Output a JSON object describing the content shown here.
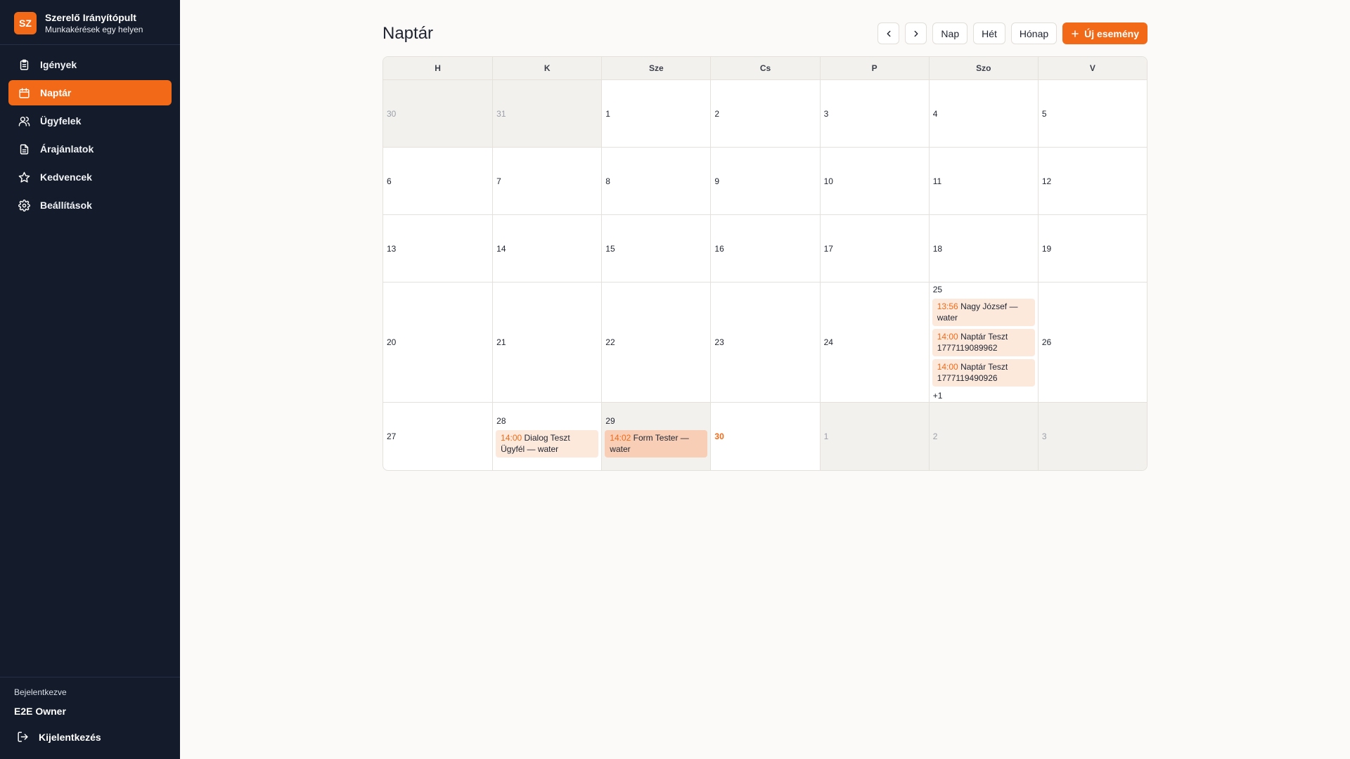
{
  "app": {
    "logo": "SZ",
    "title": "Szerelő Irányítópult",
    "subtitle": "Munkakérések egy helyen"
  },
  "nav": [
    {
      "label": "Igények",
      "icon": "clipboard-icon",
      "active": false
    },
    {
      "label": "Naptár",
      "icon": "calendar-icon",
      "active": true
    },
    {
      "label": "Ügyfelek",
      "icon": "users-icon",
      "active": false
    },
    {
      "label": "Árajánlatok",
      "icon": "document-icon",
      "active": false
    },
    {
      "label": "Kedvencek",
      "icon": "star-icon",
      "active": false
    },
    {
      "label": "Beállítások",
      "icon": "gear-icon",
      "active": false
    }
  ],
  "footer": {
    "logged_in_label": "Bejelentkezve",
    "user_name": "E2E Owner",
    "logout_label": "Kijelentkezés"
  },
  "page": {
    "title": "Naptár"
  },
  "toolbar": {
    "day_label": "Nap",
    "week_label": "Hét",
    "month_label": "Hónap",
    "new_event_label": "Új esemény"
  },
  "calendar": {
    "weekdays": [
      "H",
      "K",
      "Sze",
      "Cs",
      "P",
      "Szo",
      "V"
    ],
    "weeks": [
      {
        "days": [
          {
            "day": "30",
            "outside": true
          },
          {
            "day": "31",
            "outside": true
          },
          {
            "day": "1"
          },
          {
            "day": "2"
          },
          {
            "day": "3"
          },
          {
            "day": "4"
          },
          {
            "day": "5"
          }
        ]
      },
      {
        "days": [
          {
            "day": "6"
          },
          {
            "day": "7"
          },
          {
            "day": "8"
          },
          {
            "day": "9"
          },
          {
            "day": "10"
          },
          {
            "day": "11"
          },
          {
            "day": "12"
          }
        ]
      },
      {
        "days": [
          {
            "day": "13"
          },
          {
            "day": "14"
          },
          {
            "day": "15"
          },
          {
            "day": "16"
          },
          {
            "day": "17"
          },
          {
            "day": "18"
          },
          {
            "day": "19"
          }
        ]
      },
      {
        "days": [
          {
            "day": "20"
          },
          {
            "day": "21"
          },
          {
            "day": "22"
          },
          {
            "day": "23"
          },
          {
            "day": "24"
          },
          {
            "day": "25",
            "events": [
              {
                "time": "13:56",
                "text": "Nagy József — water"
              },
              {
                "time": "14:00",
                "text": "Naptár Teszt 1777119089962"
              },
              {
                "time": "14:00",
                "text": "Naptár Teszt 1777119490926"
              }
            ],
            "more": "+1"
          },
          {
            "day": "26"
          }
        ]
      },
      {
        "days": [
          {
            "day": "27"
          },
          {
            "day": "28",
            "events": [
              {
                "time": "14:00",
                "text": "Dialog Teszt Ügyfél — water"
              }
            ]
          },
          {
            "day": "29",
            "events": [
              {
                "time": "14:02",
                "text": "Form Tester — water",
                "strong": true
              }
            ],
            "selected": true
          },
          {
            "day": "30",
            "today": true
          },
          {
            "day": "1",
            "outside": true
          },
          {
            "day": "2",
            "outside": true
          },
          {
            "day": "3",
            "outside": true
          }
        ]
      }
    ]
  },
  "colors": {
    "accent": "#f26a17",
    "sidebar_bg": "#141c2b",
    "event_bg": "#fde9dc",
    "outside_bg": "#f3f1ee"
  }
}
